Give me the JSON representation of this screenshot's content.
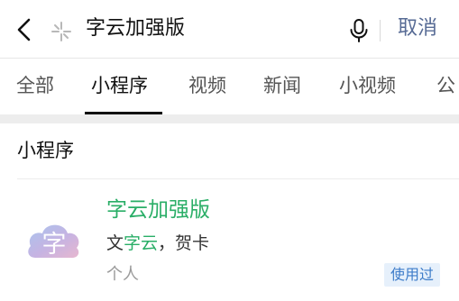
{
  "search": {
    "query": "字云加强版",
    "cancel_label": "取消"
  },
  "tabs": [
    {
      "label": "全部"
    },
    {
      "label": "小程序"
    },
    {
      "label": "视频"
    },
    {
      "label": "新闻"
    },
    {
      "label": "小视频"
    },
    {
      "label": "公"
    }
  ],
  "active_tab": "小程序",
  "section": {
    "title": "小程序"
  },
  "result": {
    "name": "字云加强版",
    "desc_prefix": "文",
    "desc_highlight": "字云",
    "desc_suffix": "，贺卡",
    "owner": "个人",
    "badge": "使用过",
    "logo_glyph": "字"
  },
  "colors": {
    "accent_green": "#2aae67",
    "link_blue": "#576b95",
    "badge_bg": "#e6f0fb",
    "badge_text": "#3d7cc9"
  },
  "icons": [
    "back-icon",
    "search-spark-icon",
    "microphone-icon"
  ]
}
